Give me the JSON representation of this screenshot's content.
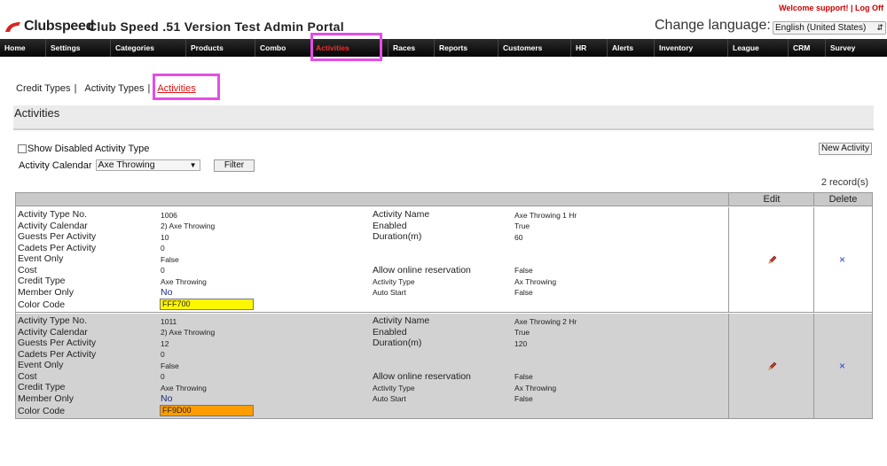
{
  "header": {
    "logo_text": "Clubspeed",
    "portal_title": "Club Speed .51 Version Test Admin Portal",
    "support_link": "Welcome support!",
    "separator": "|",
    "logoff_link": "Log Off",
    "change_language_label": "Change language:",
    "language_selected": "English (United States)"
  },
  "nav": {
    "items": [
      "Home",
      "Settings",
      "Categories",
      "Products",
      "Combo",
      "Activities",
      "Races",
      "Reports",
      "Customers",
      "HR",
      "Alerts",
      "Inventory",
      "League",
      "CRM",
      "Survey"
    ],
    "active": "Activities"
  },
  "subnav": {
    "credit_types": "Credit Types",
    "activity_types": "Activity Types",
    "activities": "Activities",
    "sep": "|"
  },
  "page": {
    "title": "Activities",
    "show_disabled_label": "Show Disabled Activity Type",
    "activity_calendar_label": "Activity Calendar",
    "activity_calendar_value": "Axe Throwing",
    "filter_button": "Filter",
    "new_activity_button": "New Activity",
    "record_count": "2 record(s)"
  },
  "grid": {
    "edit_header": "Edit",
    "delete_header": "Delete",
    "labels": {
      "type_no": "Activity Type No.",
      "calendar": "Activity Calendar",
      "guests": "Guests Per Activity",
      "cadets": "Cadets Per Activity",
      "event_only": "Event Only",
      "cost": "Cost",
      "credit_type": "Credit Type",
      "member_only": "Member Only",
      "color_code": "Color Code",
      "activity_name": "Activity Name",
      "enabled": "Enabled",
      "duration": "Duration(m)",
      "allow_online": "Allow online reservation",
      "activity_type": "Activity Type",
      "auto_start": "Auto Start"
    },
    "rows": [
      {
        "type_no": "1006",
        "calendar": "2) Axe Throwing",
        "guests": "10",
        "cadets": "0",
        "event_only": "False",
        "cost": "0",
        "credit_type": "Axe Throwing",
        "member_only": "No",
        "color_code": "FFF700",
        "color_hex": "#FFF700",
        "activity_name": "Axe Throwing 1 Hr",
        "enabled": "True",
        "duration": "60",
        "allow_online": "False",
        "activity_type": "Ax Throwing",
        "auto_start": "False"
      },
      {
        "type_no": "1011",
        "calendar": "2) Axe Throwing",
        "guests": "12",
        "cadets": "0",
        "event_only": "False",
        "cost": "0",
        "credit_type": "Axe Throwing",
        "member_only": "No",
        "color_code": "FF9D00",
        "color_hex": "#FF9D00",
        "activity_name": "Axe Throwing 2 Hr",
        "enabled": "True",
        "duration": "120",
        "allow_online": "False",
        "activity_type": "Ax Throwing",
        "auto_start": "False"
      }
    ]
  },
  "colors": {
    "nav_bg": "#111111",
    "nav_active": "#ff2a2a",
    "highlight": "#e64de6",
    "alt_row": "#d2d2d2"
  }
}
